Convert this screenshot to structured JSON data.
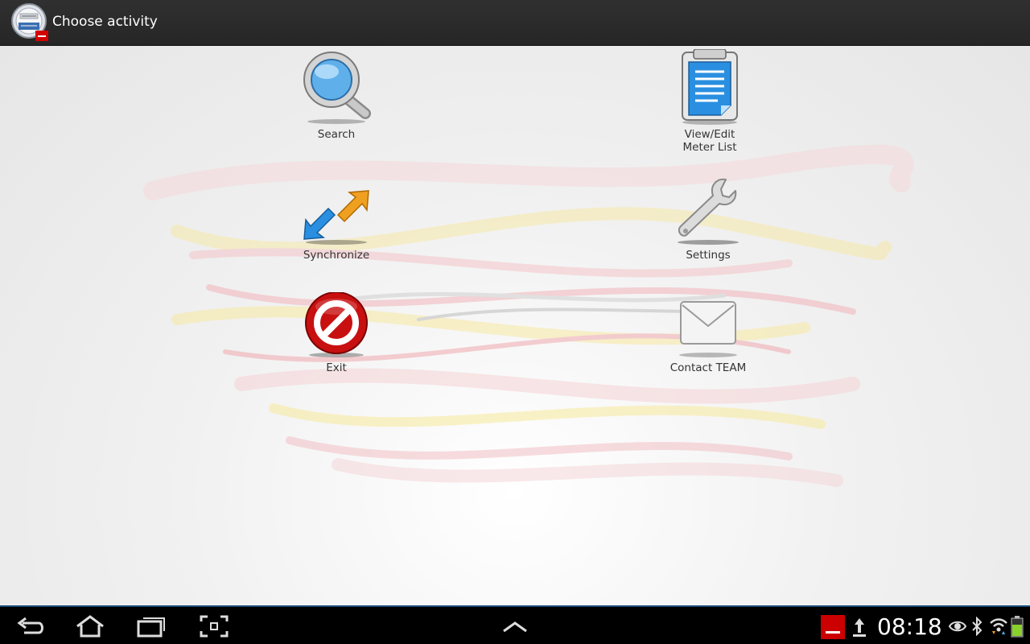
{
  "actionbar": {
    "title": "Choose activity"
  },
  "activities": [
    {
      "id": "search",
      "label": "Search"
    },
    {
      "id": "view-edit",
      "label": "View/Edit\nMeter List"
    },
    {
      "id": "synchronize",
      "label": "Synchronize"
    },
    {
      "id": "settings",
      "label": "Settings"
    },
    {
      "id": "exit",
      "label": "Exit"
    },
    {
      "id": "contact",
      "label": "Contact TEAM"
    }
  ],
  "statusbar": {
    "time": "08:18",
    "notification_icons": [
      "team-app-icon",
      "upload-icon"
    ],
    "status_icons": [
      "eye-icon",
      "bluetooth-icon",
      "wifi-icon",
      "battery-icon"
    ]
  },
  "colors": {
    "accent": "#1a4a7a",
    "brand_red": "#cc0000"
  }
}
